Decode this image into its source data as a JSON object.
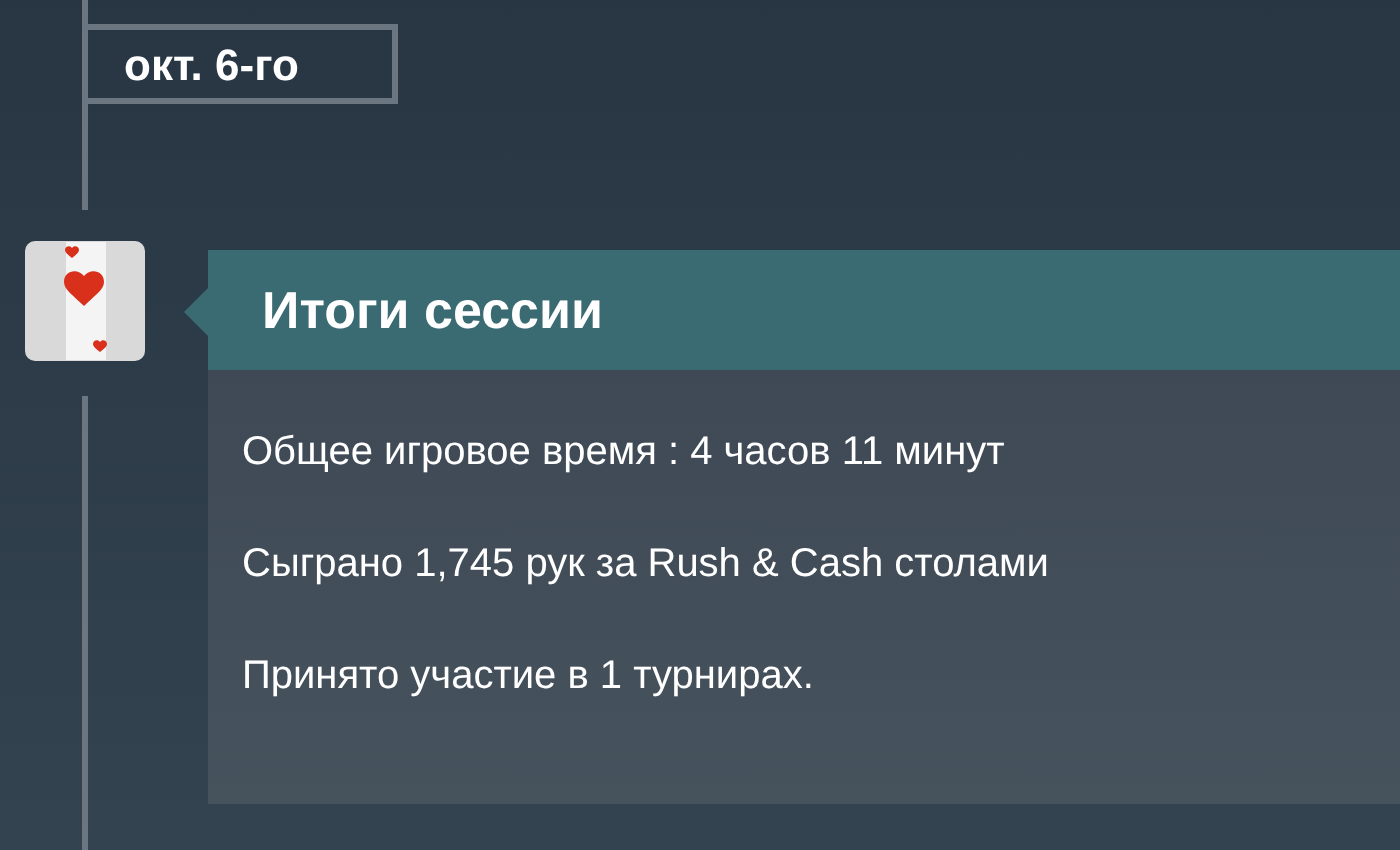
{
  "date_label": "окт. 6-го",
  "session": {
    "title": "Итоги сессии",
    "lines": [
      "Общее игровое время : 4 часов 11 минут",
      "Сыграно 1,745 рук за Rush & Cash столами",
      "Принято участие в 1 турнирах."
    ]
  }
}
